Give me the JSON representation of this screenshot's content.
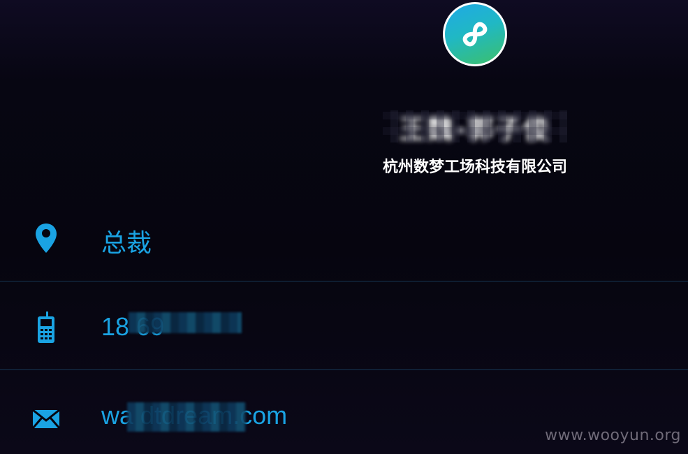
{
  "card": {
    "name": "王魏-郭子俊",
    "company": "杭州数梦工场科技有限公司",
    "logo": "infinity-logo"
  },
  "rows": [
    {
      "icon": "location-pin-icon",
      "text": "总裁"
    },
    {
      "icon": "mobile-phone-icon",
      "text": "18          69"
    },
    {
      "icon": "mail-icon",
      "text": "wa           dtdream.com"
    }
  ],
  "watermark": "www.wooyun.org",
  "colors": {
    "accent": "#1aa3e3",
    "background": "#06050f",
    "divider": "#163754"
  }
}
